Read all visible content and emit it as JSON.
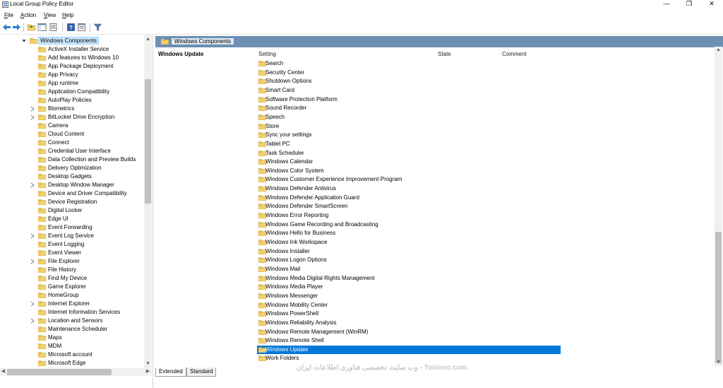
{
  "window": {
    "title": "Local Group Policy Editor"
  },
  "menu": {
    "items": [
      {
        "mnemonic": "F",
        "rest": "ile"
      },
      {
        "mnemonic": "A",
        "rest": "ction"
      },
      {
        "mnemonic": "V",
        "rest": "iew"
      },
      {
        "mnemonic": "H",
        "rest": "elp"
      }
    ]
  },
  "tree": {
    "root": "Windows Components",
    "items": [
      {
        "label": "ActiveX Installer Service",
        "expandable": false
      },
      {
        "label": "Add features to Windows 10",
        "expandable": false
      },
      {
        "label": "App Package Deployment",
        "expandable": false
      },
      {
        "label": "App Privacy",
        "expandable": false
      },
      {
        "label": "App runtime",
        "expandable": false
      },
      {
        "label": "Application Compatibility",
        "expandable": false
      },
      {
        "label": "AutoPlay Policies",
        "expandable": false
      },
      {
        "label": "Biometrics",
        "expandable": true
      },
      {
        "label": "BitLocker Drive Encryption",
        "expandable": true
      },
      {
        "label": "Camera",
        "expandable": false
      },
      {
        "label": "Cloud Content",
        "expandable": false
      },
      {
        "label": "Connect",
        "expandable": false
      },
      {
        "label": "Credential User Interface",
        "expandable": false
      },
      {
        "label": "Data Collection and Preview Builds",
        "expandable": false
      },
      {
        "label": "Delivery Optimization",
        "expandable": false
      },
      {
        "label": "Desktop Gadgets",
        "expandable": false
      },
      {
        "label": "Desktop Window Manager",
        "expandable": true
      },
      {
        "label": "Device and Driver Compatibility",
        "expandable": false
      },
      {
        "label": "Device Registration",
        "expandable": false
      },
      {
        "label": "Digital Locker",
        "expandable": false
      },
      {
        "label": "Edge UI",
        "expandable": false
      },
      {
        "label": "Event Forwarding",
        "expandable": false
      },
      {
        "label": "Event Log Service",
        "expandable": true
      },
      {
        "label": "Event Logging",
        "expandable": false
      },
      {
        "label": "Event Viewer",
        "expandable": false
      },
      {
        "label": "File Explorer",
        "expandable": true
      },
      {
        "label": "File History",
        "expandable": false
      },
      {
        "label": "Find My Device",
        "expandable": false
      },
      {
        "label": "Game Explorer",
        "expandable": false
      },
      {
        "label": "HomeGroup",
        "expandable": false
      },
      {
        "label": "Internet Explorer",
        "expandable": true
      },
      {
        "label": "Internet Information Services",
        "expandable": false
      },
      {
        "label": "Location and Sensors",
        "expandable": true
      },
      {
        "label": "Maintenance Scheduler",
        "expandable": false
      },
      {
        "label": "Maps",
        "expandable": false
      },
      {
        "label": "MDM",
        "expandable": false
      },
      {
        "label": "Microsoft account",
        "expandable": false
      },
      {
        "label": "Microsoft Edge",
        "expandable": false
      }
    ]
  },
  "header": {
    "folder_title": "Windows Components"
  },
  "detail": {
    "title": "Windows Update",
    "columns": {
      "setting": "Setting",
      "state": "State",
      "comment": "Comment"
    },
    "items": [
      "Search",
      "Security Center",
      "Shutdown Options",
      "Smart Card",
      "Software Protection Platform",
      "Sound Recorder",
      "Speech",
      "Store",
      "Sync your settings",
      "Tablet PC",
      "Task Scheduler",
      "Windows Calendar",
      "Windows Color System",
      "Windows Customer Experience Improvement Program",
      "Windows Defender Antivirus",
      "Windows Defender Application Guard",
      "Windows Defender SmartScreen",
      "Windows Error Reporting",
      "Windows Game Recording and Broadcasting",
      "Windows Hello for Business",
      "Windows Ink Workspace",
      "Windows Installer",
      "Windows Logon Options",
      "Windows Mail",
      "Windows Media Digital Rights Management",
      "Windows Media Player",
      "Windows Messenger",
      "Windows Mobility Center",
      "Windows PowerShell",
      "Windows Reliability Analysis",
      "Windows Remote Management (WinRM)",
      "Windows Remote Shell",
      "Windows Update",
      "Work Folders"
    ],
    "selected": "Windows Update"
  },
  "tabs": {
    "extended": "Extended",
    "standard": "Standard"
  },
  "watermark": {
    "text": "وب سایت تخصصی فناوری اطلاعات ایران - Tosinso.com"
  },
  "colors": {
    "selection": "#0078d7",
    "header_band": "#6d8fb3",
    "folder": "#f4cf6b"
  }
}
